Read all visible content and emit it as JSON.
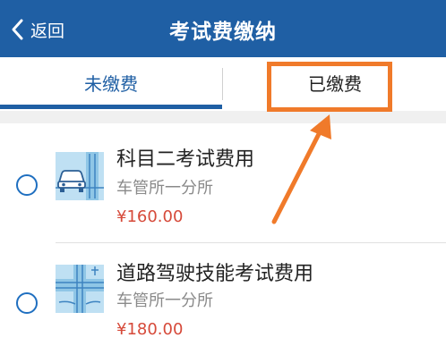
{
  "header": {
    "back_label": "返回",
    "title": "考试费缴纳"
  },
  "tabs": [
    {
      "label": "未缴费",
      "selected": true
    },
    {
      "label": "已缴费",
      "selected": false
    }
  ],
  "fee_items": [
    {
      "name": "科目二考试费用",
      "office": "车管所一分所",
      "price": "¥160.00",
      "icon": "car-road-icon"
    },
    {
      "name": "道路驾驶技能考试费用",
      "office": "车管所一分所",
      "price": "¥180.00",
      "icon": "road-junction-icon"
    }
  ],
  "annotation": {
    "color": "#f07a2a",
    "description_target": "已缴费"
  },
  "colors": {
    "header_bg": "#1f5fa4",
    "accent": "#1f5fa4",
    "price": "#d64a3a"
  }
}
